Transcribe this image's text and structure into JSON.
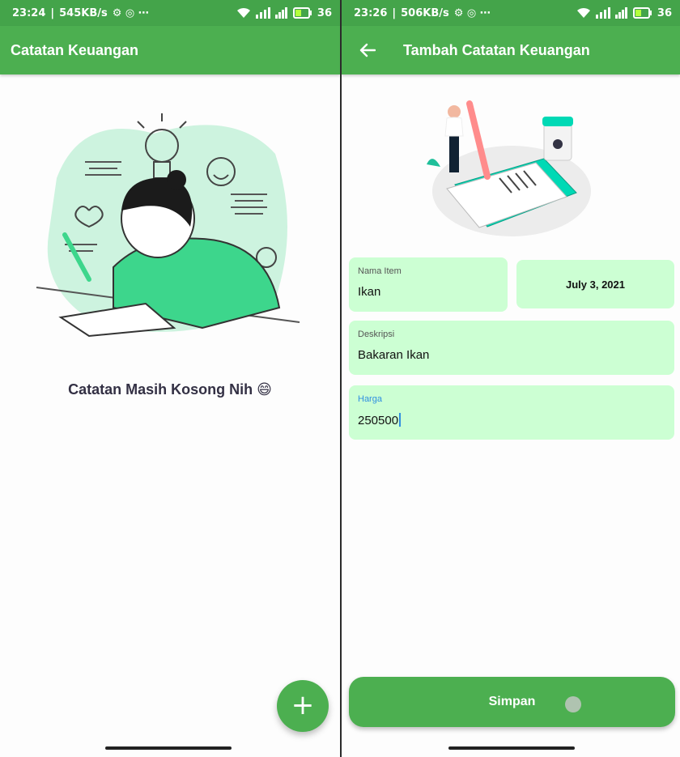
{
  "left": {
    "status": {
      "time": "23:24",
      "speed": "545KB/s",
      "battery": "36"
    },
    "appbar": {
      "title": "Catatan Keuangan"
    },
    "empty_text": "Catatan Masih Kosong Nih",
    "empty_emoji": "😄",
    "fab": {
      "label": "+",
      "icon": "plus-icon"
    }
  },
  "right": {
    "status": {
      "time": "23:26",
      "speed": "506KB/s",
      "battery": "36"
    },
    "appbar": {
      "title": "Tambah Catatan Keuangan",
      "back_icon": "arrow-left-icon"
    },
    "form": {
      "nama_item": {
        "label": "Nama Item",
        "value": "Ikan"
      },
      "date": "July 3, 2021",
      "deskripsi": {
        "label": "Deskripsi",
        "value": "Bakaran Ikan"
      },
      "harga": {
        "label": "Harga",
        "value": "250500"
      }
    },
    "save_label": "Simpan"
  },
  "colors": {
    "primary": "#4caf50",
    "status_bar": "#44a44a",
    "field_bg": "#ccffd3",
    "accent": "#2f8fe0"
  }
}
